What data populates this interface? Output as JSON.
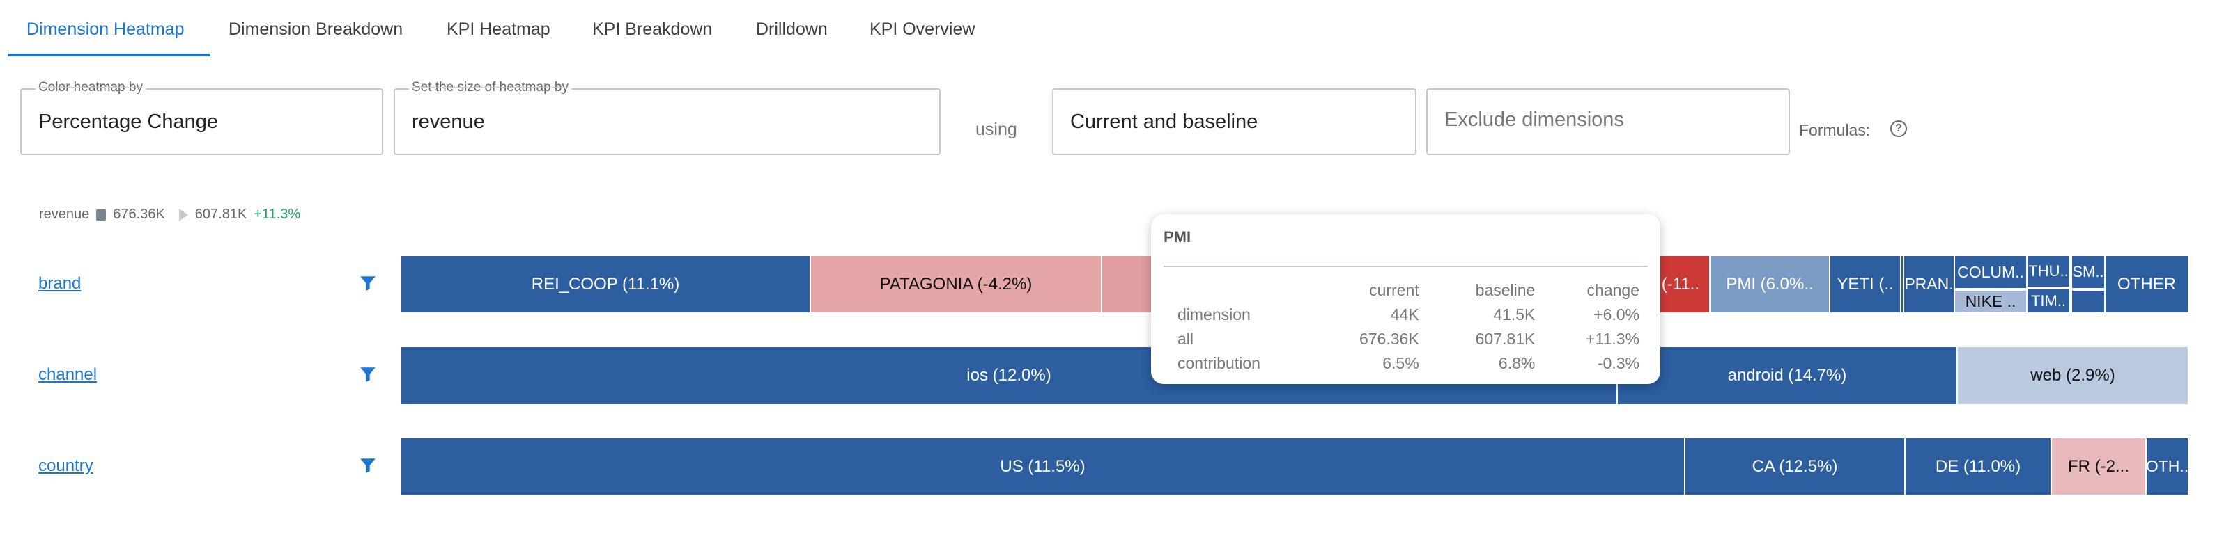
{
  "tabs": [
    {
      "label": "Dimension Heatmap",
      "active": true
    },
    {
      "label": "Dimension Breakdown",
      "active": false
    },
    {
      "label": "KPI Heatmap",
      "active": false
    },
    {
      "label": "KPI Breakdown",
      "active": false
    },
    {
      "label": "Drilldown",
      "active": false
    },
    {
      "label": "KPI Overview",
      "active": false
    }
  ],
  "controls": {
    "color_by": {
      "label": "Color heatmap by",
      "value": "Percentage Change"
    },
    "size_by": {
      "label": "Set the size of heatmap by",
      "value": "revenue"
    },
    "using_label": "using",
    "mode": {
      "value": "Current and baseline"
    },
    "exclude": {
      "placeholder": "Exclude dimensions"
    },
    "formulas_label": "Formulas:",
    "help_icon": "?"
  },
  "legend": {
    "metric": "revenue",
    "current": "676.36K",
    "baseline": "607.81K",
    "change": "+11.3%"
  },
  "colors": {
    "positive": "#2c5ea0",
    "mild_positive": "#7b9ac4",
    "light_positive": "#a6bad8",
    "neutral_light": "#b9c9e0",
    "mild_negative": "#e4a6a7",
    "negative_mid": "#e09c9e",
    "strong_negative": "#cc3a38",
    "light_negative": "#e8b9ba"
  },
  "rows": [
    {
      "dimension": "brand",
      "segments": [
        {
          "label": "REI_COOP (11.1%)",
          "color": "#2c5ea0"
        },
        {
          "label": "PATAGONIA (-4.2%)",
          "color": "#e4a6a7",
          "dark": true
        },
        {
          "label": "",
          "color": "#e09c9e",
          "dark": true
        },
        {
          "label": "(-11..",
          "color": "#cc3a38"
        },
        {
          "label": "PMI (6.0%..",
          "color": "#7b9ac4"
        },
        {
          "label": "YETI (..",
          "color": "#2c5ea0"
        },
        {
          "label": "",
          "color": "#2c5ea0"
        },
        {
          "label": "PRAN.",
          "color": "#2c5ea0"
        },
        {
          "label": "COLUM..",
          "color": "#2c5ea0"
        },
        {
          "label": "NIKE ..",
          "color": "#a6bad8",
          "dark": true
        },
        {
          "label": "THU..",
          "color": "#2c5ea0"
        },
        {
          "label": "TIM..",
          "color": "#2c5ea0"
        },
        {
          "label": "SM..",
          "color": "#2c5ea0"
        },
        {
          "label": "",
          "color": "#2c5ea0"
        },
        {
          "label": "OTHER",
          "color": "#2c5ea0"
        }
      ]
    },
    {
      "dimension": "channel",
      "segments": [
        {
          "label": "ios (12.0%)",
          "color": "#2c5ea0"
        },
        {
          "label": "android (14.7%)",
          "color": "#2c5ea0"
        },
        {
          "label": "web (2.9%)",
          "color": "#b9c9e0",
          "dark": true
        }
      ]
    },
    {
      "dimension": "country",
      "segments": [
        {
          "label": "US (11.5%)",
          "color": "#2c5ea0"
        },
        {
          "label": "CA (12.5%)",
          "color": "#2c5ea0"
        },
        {
          "label": "DE (11.0%)",
          "color": "#2c5ea0"
        },
        {
          "label": "FR (-2...",
          "color": "#e8b9ba",
          "dark": true
        },
        {
          "label": "OTH..",
          "color": "#2c5ea0"
        }
      ]
    }
  ],
  "tooltip": {
    "title": "PMI",
    "headers": [
      "",
      "current",
      "baseline",
      "change"
    ],
    "rows": [
      [
        "dimension",
        "44K",
        "41.5K",
        "+6.0%"
      ],
      [
        "all",
        "676.36K",
        "607.81K",
        "+11.3%"
      ],
      [
        "contribution",
        "6.5%",
        "6.8%",
        "-0.3%"
      ]
    ]
  }
}
